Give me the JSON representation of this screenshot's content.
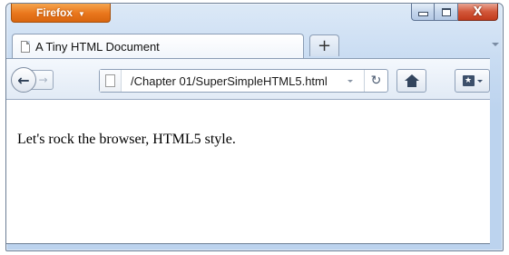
{
  "app_menu": {
    "label": "Firefox",
    "caret": "▼"
  },
  "window_controls": {
    "minimize": "minimize",
    "maximize": "maximize",
    "close": "X"
  },
  "tabs": [
    {
      "title": "A Tiny HTML Document",
      "icon": "page-icon"
    }
  ],
  "new_tab": {
    "label": "+"
  },
  "navigation": {
    "back_icon": "←",
    "forward_icon": "→",
    "url": "/Chapter 01/SuperSimpleHTML5.html",
    "reload_icon": "↻"
  },
  "page": {
    "text": "Let's rock the browser, HTML5 style."
  },
  "colors": {
    "app_button": "#e9761c",
    "close_button": "#d2573a",
    "chrome": "#c9dcf2"
  }
}
